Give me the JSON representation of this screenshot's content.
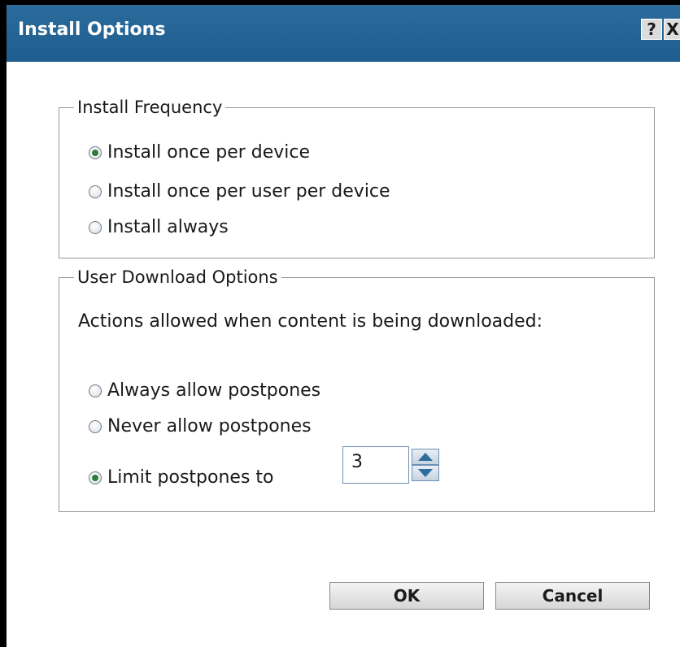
{
  "dialog": {
    "title": "Install Options",
    "help_label": "?",
    "close_label": "X"
  },
  "install_frequency": {
    "legend": "Install Frequency",
    "options": [
      {
        "label": "Install once per device",
        "checked": true
      },
      {
        "label": "Install once per user per device",
        "checked": false
      },
      {
        "label": "Install always",
        "checked": false
      }
    ]
  },
  "user_download": {
    "legend": "User Download Options",
    "description": "Actions allowed when content is being downloaded:",
    "options": [
      {
        "label": "Always allow postpones",
        "checked": false
      },
      {
        "label": "Never allow postpones",
        "checked": false
      },
      {
        "label": "Limit postpones to",
        "checked": true
      }
    ],
    "postpone_limit": "3"
  },
  "buttons": {
    "ok_label": "OK",
    "cancel_label": "Cancel"
  },
  "colors": {
    "title_bar": "#2b6c9c",
    "radio_checked": "#2f7d3b",
    "group_border": "#9a9a9a"
  },
  "icons": {
    "spin_up": "triangle-up-icon",
    "spin_down": "triangle-down-icon"
  }
}
